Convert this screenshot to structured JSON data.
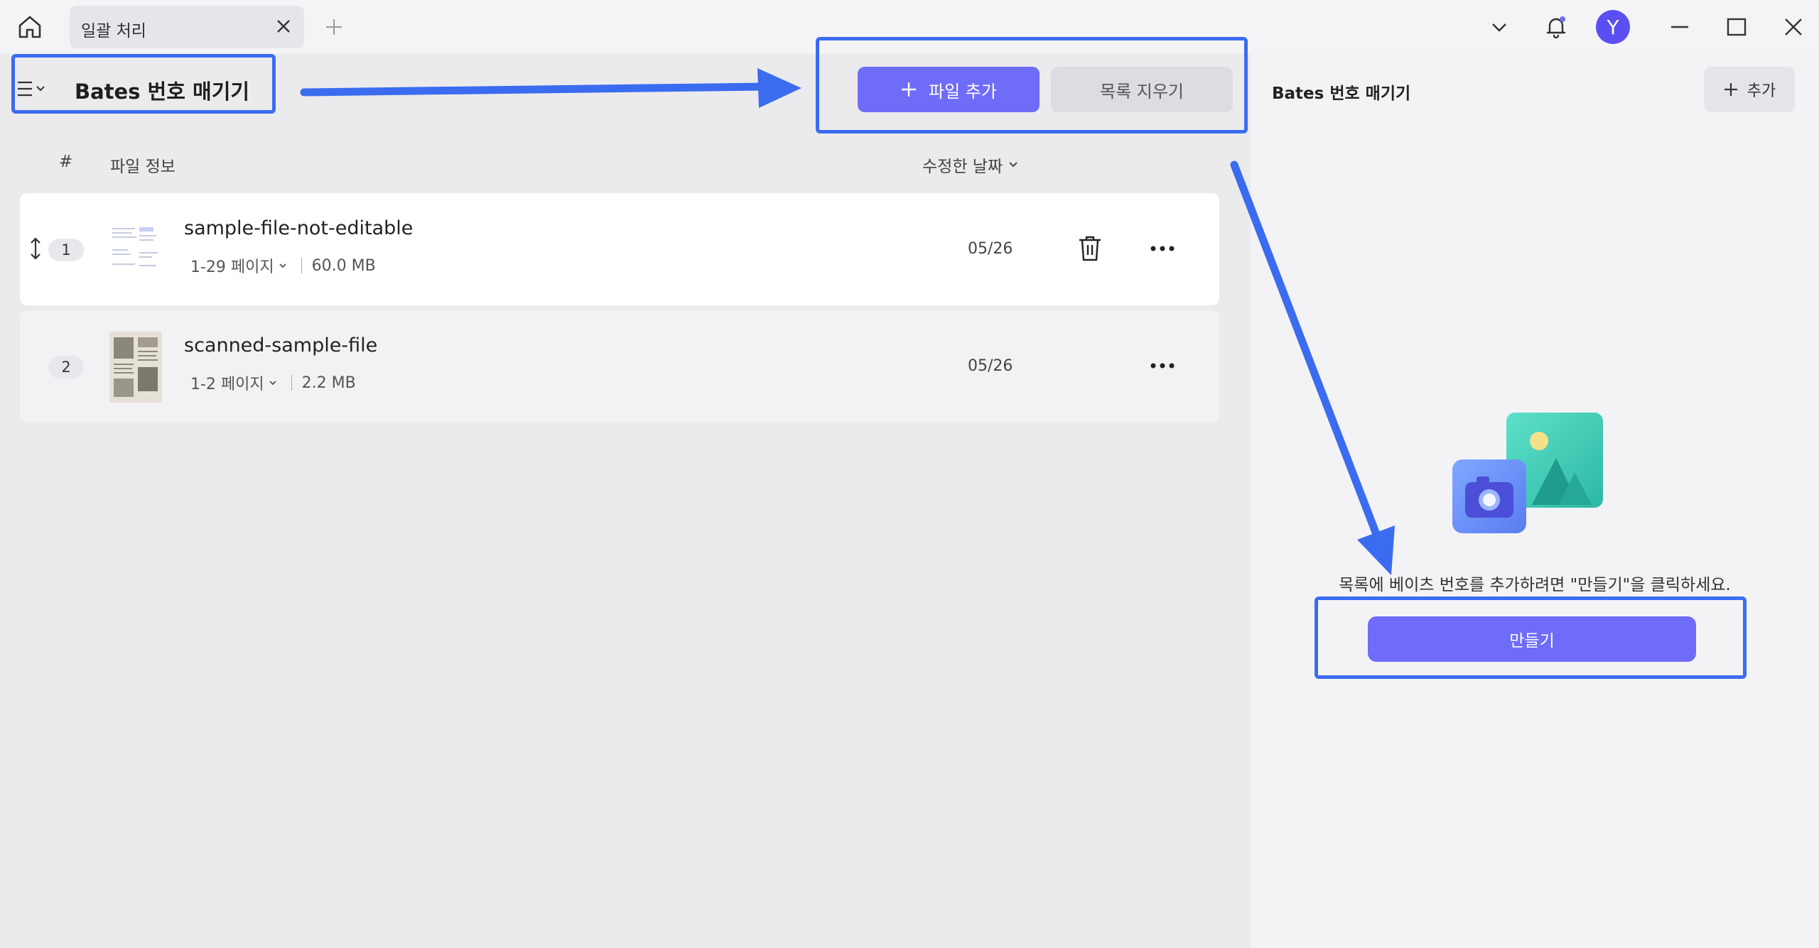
{
  "titlebar": {
    "tab_label": "일괄 처리",
    "avatar_initial": "Y"
  },
  "left": {
    "title": "Bates 번호 매기기",
    "add_file_label": "파일 추가",
    "clear_list_label": "목록 지우기",
    "columns": {
      "index": "#",
      "file_info": "파일 정보",
      "modified_date": "수정한 날짜"
    },
    "files": [
      {
        "index": "1",
        "name": "sample-file-not-editable",
        "pages": "1-29 페이지",
        "size": "60.0 MB",
        "date": "05/26"
      },
      {
        "index": "2",
        "name": "scanned-sample-file",
        "pages": "1-2 페이지",
        "size": "2.2 MB",
        "date": "05/26"
      }
    ]
  },
  "right": {
    "title": "Bates 번호 매기기",
    "add_label": "추가",
    "hint": "목록에 베이츠 번호를 추가하려면 \"만들기\"을 클릭하세요.",
    "create_label": "만들기"
  },
  "colors": {
    "accent": "#6f6cf8",
    "annotation": "#3b6cf0",
    "avatar": "#5b4ff4"
  }
}
